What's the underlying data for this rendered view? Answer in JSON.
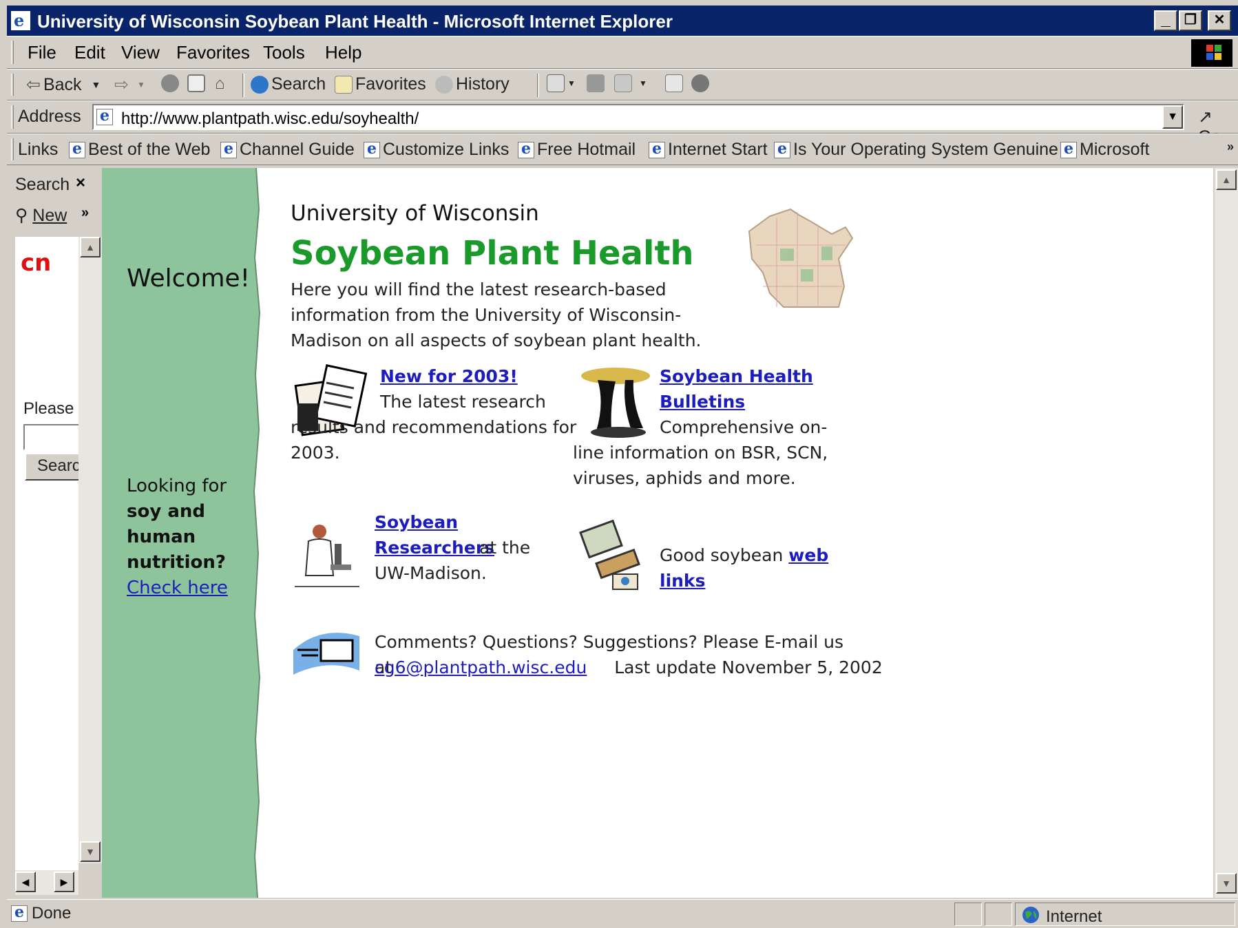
{
  "window": {
    "title": "University of Wisconsin Soybean Plant Health - Microsoft Internet Explorer",
    "minimize_label": "_",
    "restore_label": "❐",
    "close_label": "✕"
  },
  "menu": {
    "file": "File",
    "edit": "Edit",
    "view": "View",
    "favorites": "Favorites",
    "tools": "Tools",
    "help": "Help"
  },
  "toolbar": {
    "back": "Back",
    "search": "Search",
    "favorites": "Favorites",
    "history": "History"
  },
  "address": {
    "label": "Address",
    "url": "http://www.plantpath.wisc.edu/soyhealth/",
    "go": "Go"
  },
  "links": {
    "label": "Links",
    "items": [
      "Best of the Web",
      "Channel Guide",
      "Customize Links",
      "Free Hotmail",
      "Internet Start",
      "Is Your Operating System Genuine",
      "Microsoft"
    ]
  },
  "search_pane": {
    "title": "Search",
    "close": "×",
    "new": "New",
    "more": "»",
    "logo": "cn",
    "prompt": "Please",
    "button": "Search"
  },
  "page": {
    "welcome": "Welcome!",
    "looking_for": "Looking for",
    "nutrition_bold": "soy and human nutrition?",
    "check_here": "Check here",
    "university": "University of Wisconsin",
    "title": "Soybean Plant Health",
    "intro": "Here you will find the latest research-based information from the University of Wisconsin-Madison on all aspects of soybean plant health.",
    "new2003_link": "New for 2003!",
    "new2003_text": "The latest research results and recommendations for 2003.",
    "bulletins_link": "Soybean Health Bulletins",
    "bulletins_text": "Comprehensive on-line information on BSR, SCN, viruses, aphids and more.",
    "researchers_link": "Soybean Researchers",
    "researchers_text_1": " at the",
    "researchers_text_2": "UW-Madison.",
    "weblinks_prefix": "Good soybean ",
    "weblinks_link": "web links",
    "comments": "Comments? Questions? Suggestions?  Please E-mail us at",
    "email": "cg6@plantpath.wisc.edu",
    "last_update": "Last update November 5, 2002"
  },
  "status": {
    "text": "Done",
    "zone": "Internet"
  }
}
